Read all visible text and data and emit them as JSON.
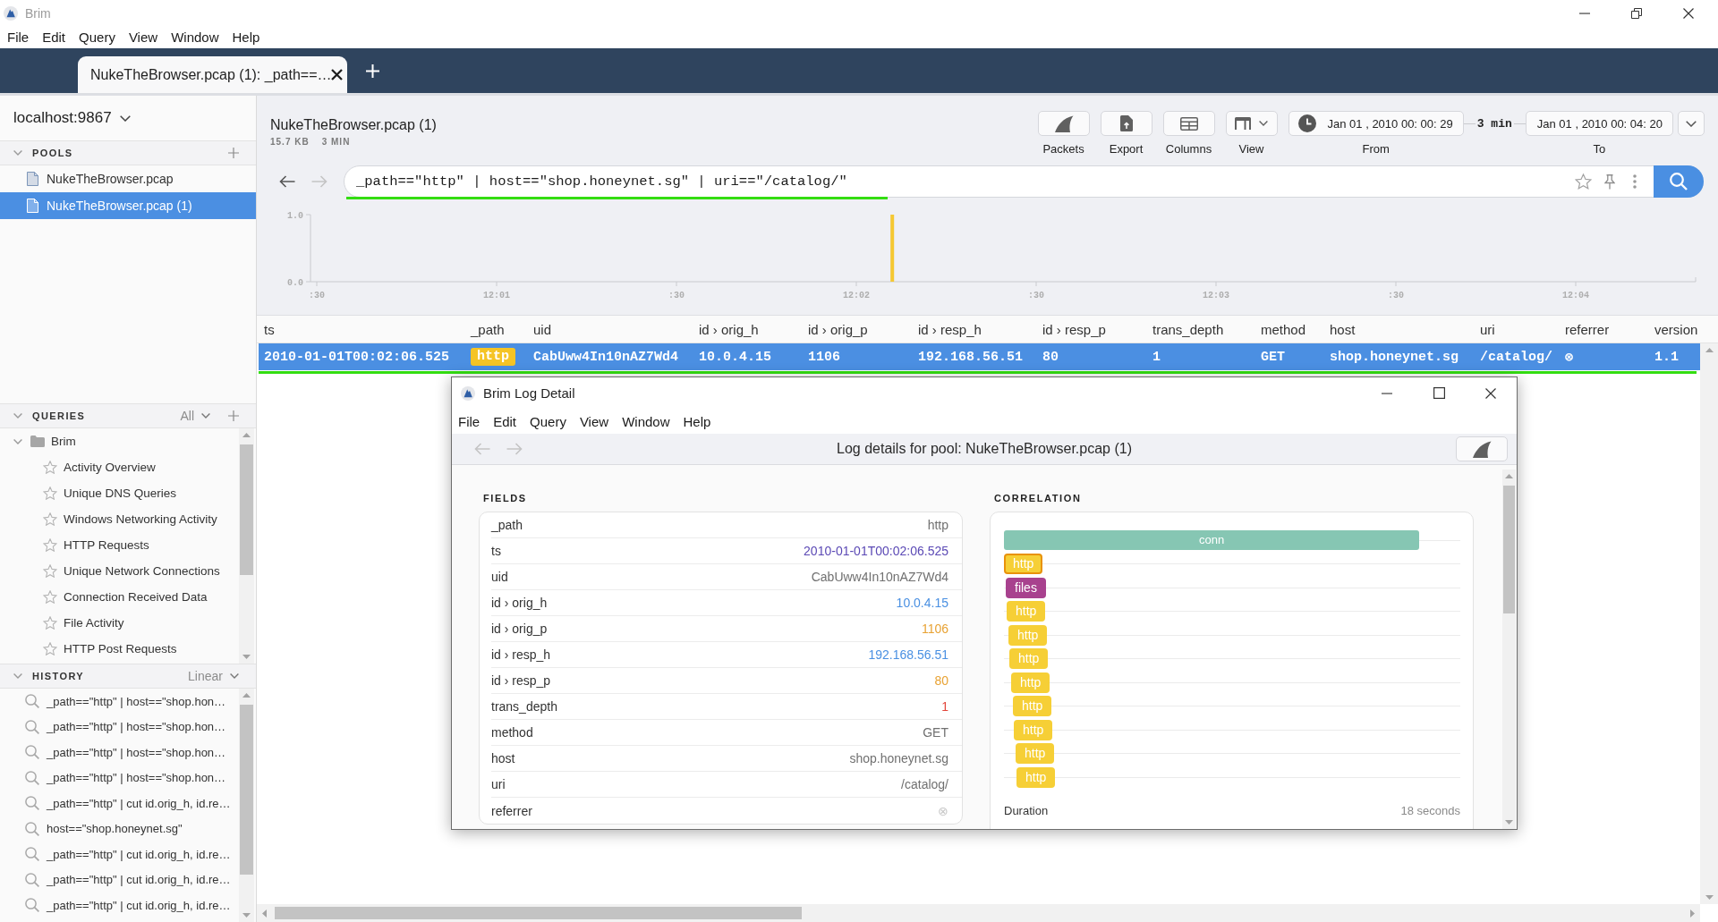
{
  "window": {
    "title": "Brim",
    "menu": [
      "File",
      "Edit",
      "Query",
      "View",
      "Window",
      "Help"
    ]
  },
  "tabs": [
    {
      "label": "NukeTheBrowser.pcap (1): _path==…",
      "selected": true
    }
  ],
  "sidebar": {
    "workspace": "localhost:9867",
    "pools": {
      "title": "POOLS",
      "expanded": true,
      "items": [
        {
          "label": "NukeTheBrowser.pcap",
          "selected": false
        },
        {
          "label": "NukeTheBrowser.pcap (1)",
          "selected": true
        }
      ]
    },
    "queries": {
      "title": "QUERIES",
      "filter": "All",
      "expanded": true,
      "children": [
        {
          "label": "Brim",
          "expanded": true,
          "children": [
            {
              "label": "Activity Overview"
            },
            {
              "label": "Unique DNS Queries"
            },
            {
              "label": "Windows Networking Activity"
            },
            {
              "label": "HTTP Requests"
            },
            {
              "label": "Unique Network Connections"
            },
            {
              "label": "Connection Received Data"
            },
            {
              "label": "File Activity"
            },
            {
              "label": "HTTP Post Requests"
            }
          ]
        }
      ]
    },
    "history": {
      "title": "HISTORY",
      "mode": "Linear",
      "expanded": true,
      "items": [
        "_path==\"http\" | host==\"shop.hon…",
        "_path==\"http\" | host==\"shop.hon…",
        "_path==\"http\" | host==\"shop.hon…",
        "_path==\"http\" | host==\"shop.hon…",
        "_path==\"http\" | cut id.orig_h, id.re…",
        "host==\"shop.honeynet.sg\"",
        "_path==\"http\" | cut id.orig_h, id.re…",
        "_path==\"http\" | cut id.orig_h, id.re…",
        "_path==\"http\" | cut id.orig_h, id.re…"
      ]
    }
  },
  "pool": {
    "title": "NukeTheBrowser.pcap (1)",
    "size": "15.7 KB",
    "span": "3 MIN"
  },
  "toolbar": [
    {
      "kind": "packets",
      "label": "Packets"
    },
    {
      "kind": "export",
      "label": "Export"
    },
    {
      "kind": "columns",
      "label": "Columns"
    },
    {
      "kind": "view",
      "label": "View"
    }
  ],
  "time_range": {
    "from": {
      "label": "From",
      "value": "Jan 01 , 2010 00: 00: 29"
    },
    "span": "3 min",
    "to": {
      "label": "To",
      "value": "Jan 01 , 2010 00: 04: 20"
    }
  },
  "nav": [
    {
      "kind": "back",
      "disabled": false
    },
    {
      "kind": "forward",
      "disabled": true
    }
  ],
  "search": {
    "value": "_path==\"http\" | host==\"shop.honeynet.sg\" | uri==\"/catalog/\"",
    "underlined": true
  },
  "histogram": {
    "chart_data": {
      "type": "bar",
      "categories": [
        ":30",
        null,
        null,
        null,
        null,
        "12:01",
        null,
        null,
        null,
        null,
        ":30",
        null,
        null,
        null,
        null,
        "12:02",
        null,
        null,
        null,
        null,
        ":30",
        null,
        null,
        null,
        null,
        "12:03",
        null,
        null,
        null,
        null,
        ":30",
        null,
        null,
        null,
        null,
        "12:04",
        null,
        null,
        null
      ],
      "values": [
        null,
        null,
        null,
        null,
        null,
        null,
        null,
        null,
        null,
        null,
        null,
        null,
        null,
        null,
        null,
        null,
        1,
        null,
        null,
        null,
        null,
        null,
        null,
        null,
        null,
        null,
        null,
        null,
        null,
        null,
        null,
        null,
        null,
        null,
        null,
        null,
        null,
        null,
        null
      ],
      "ylim": [
        0,
        1
      ],
      "yticks": [
        {
          "value": 0,
          "label": "0.0"
        },
        {
          "value": 1,
          "label": "1.0"
        }
      ]
    }
  },
  "table": {
    "columns": [
      "ts",
      "_path",
      "uid",
      "id › orig_h",
      "id › orig_p",
      "id › resp_h",
      "id › resp_p",
      "trans_depth",
      "method",
      "host",
      "uri",
      "referrer",
      "version"
    ],
    "rows": [
      {
        "selected": true,
        "underlined": true,
        "cells": [
          {
            "kind": "text",
            "value": "2010-01-01T00:02:06.525"
          },
          {
            "kind": "badge",
            "value": "http"
          },
          {
            "kind": "text",
            "value": "CabUww4In10nAZ7Wd4"
          },
          {
            "kind": "text",
            "value": "10.0.4.15"
          },
          {
            "kind": "text",
            "value": "1106"
          },
          {
            "kind": "text",
            "value": "192.168.56.51"
          },
          {
            "kind": "text",
            "value": "80"
          },
          {
            "kind": "text",
            "value": "1"
          },
          {
            "kind": "text",
            "value": "GET"
          },
          {
            "kind": "text",
            "value": "shop.honeynet.sg"
          },
          {
            "kind": "text",
            "value": "/catalog/"
          },
          {
            "kind": "text",
            "value": "⊗"
          },
          {
            "kind": "text",
            "value": "1.1"
          }
        ]
      }
    ]
  },
  "log_detail": {
    "title": "Brim Log Detail",
    "menu": [
      "File",
      "Edit",
      "Query",
      "View",
      "Window",
      "Help"
    ],
    "nav": [
      {
        "kind": "back",
        "disabled": true
      },
      {
        "kind": "forward",
        "disabled": true
      }
    ],
    "heading": "Log details for pool: NukeTheBrowser.pcap (1)",
    "fields": {
      "title": "FIELDS",
      "rows": [
        {
          "name": "_path",
          "value": "http",
          "kind": "string"
        },
        {
          "name": "ts",
          "value": "2010-01-01T00:02:06.525",
          "kind": "time"
        },
        {
          "name": "uid",
          "value": "CabUww4In10nAZ7Wd4",
          "kind": "string"
        },
        {
          "name": "id › orig_h",
          "value": "10.0.4.15",
          "kind": "addr"
        },
        {
          "name": "id › orig_p",
          "value": "1106",
          "kind": "port"
        },
        {
          "name": "id › resp_h",
          "value": "192.168.56.51",
          "kind": "addr"
        },
        {
          "name": "id › resp_p",
          "value": "80",
          "kind": "port"
        },
        {
          "name": "trans_depth",
          "value": "1",
          "kind": "count"
        },
        {
          "name": "method",
          "value": "GET",
          "kind": "string"
        },
        {
          "name": "host",
          "value": "shop.honeynet.sg",
          "kind": "string"
        },
        {
          "name": "uri",
          "value": "/catalog/",
          "kind": "string"
        },
        {
          "name": "referrer",
          "value": "⊗",
          "kind": "null"
        }
      ]
    },
    "correlation": {
      "title": "CORRELATION",
      "items": [
        {
          "label": "conn",
          "kind": "span",
          "color": "#86c6b3",
          "selected": false
        },
        {
          "label": "http",
          "kind": "event",
          "color": "#f6cf36",
          "selected": true
        },
        {
          "label": "files",
          "kind": "event",
          "color": "#a8418e",
          "selected": false
        },
        {
          "label": "http",
          "kind": "event",
          "color": "#f6cf36",
          "selected": false
        },
        {
          "label": "http",
          "kind": "event",
          "color": "#f6cf36",
          "selected": false
        },
        {
          "label": "http",
          "kind": "event",
          "color": "#f6cf36",
          "selected": false
        },
        {
          "label": "http",
          "kind": "event",
          "color": "#f6cf36",
          "selected": false
        },
        {
          "label": "http",
          "kind": "event",
          "color": "#f6cf36",
          "selected": false
        },
        {
          "label": "http",
          "kind": "event",
          "color": "#f6cf36",
          "selected": false
        },
        {
          "label": "http",
          "kind": "event",
          "color": "#f6cf36",
          "selected": false
        },
        {
          "label": "http",
          "kind": "event",
          "color": "#f6cf36",
          "selected": false
        }
      ],
      "duration_label": "Duration",
      "duration": "18 seconds"
    }
  }
}
